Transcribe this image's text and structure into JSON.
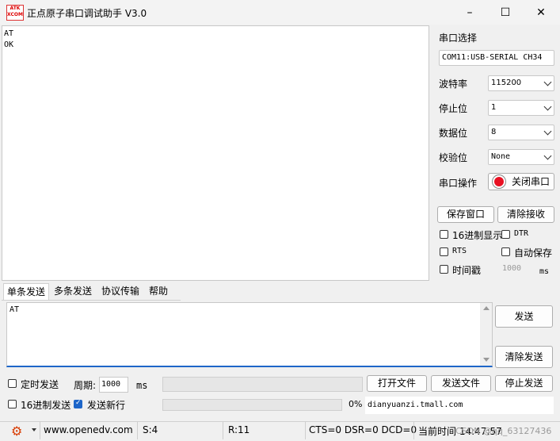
{
  "window": {
    "title": "正点原子串口调试助手 V3.0",
    "logo_top": "ATK",
    "logo_bottom": "XCOM",
    "minimize_icon": "–",
    "maximize_icon": "☐",
    "close_icon": "✕"
  },
  "receive": {
    "text": "AT\nOK"
  },
  "panel": {
    "port_select_label": "串口选择",
    "port_value": "COM11:USB-SERIAL CH34",
    "baud_label": "波特率",
    "baud_value": "115200",
    "stop_label": "停止位",
    "stop_value": "1",
    "data_label": "数据位",
    "data_value": "8",
    "parity_label": "校验位",
    "parity_value": "None",
    "port_op_label": "串口操作",
    "close_port_button": "关闭串口",
    "save_window_button": "保存窗口",
    "clear_recv_button": "清除接收",
    "hex_display_label": "16进制显示",
    "dtr_label": "DTR",
    "rts_label": "RTS",
    "auto_save_label": "自动保存",
    "timestamp_label": "时间戳",
    "timestamp_value": "1000",
    "timestamp_unit": "ms"
  },
  "tabs": [
    "单条发送",
    "多条发送",
    "协议传输",
    "帮助"
  ],
  "send": {
    "text": "AT",
    "send_button": "发送",
    "clear_send_button": "清除发送"
  },
  "bottom": {
    "timed_send_label": "定时发送",
    "period_label": "周期:",
    "period_value": "1000",
    "period_unit": "ms",
    "open_file_button": "打开文件",
    "send_file_button": "发送文件",
    "stop_send_button": "停止发送",
    "hex_send_label": "16进制发送",
    "send_newline_label": "发送新行",
    "progress_text": "0%",
    "progress": 0,
    "shop_text": "dianyuanzi.tmall.com"
  },
  "status": {
    "website": "www.openedv.com",
    "sent": "S:4",
    "received": "R:11",
    "signals": "CTS=0 DSR=0 DCD=0",
    "time": "当前时间 14:47:57",
    "watermark": "CSDN @qq_63127436"
  },
  "colors": {
    "accent": "#1e66c9",
    "record_red": "#e81123"
  }
}
